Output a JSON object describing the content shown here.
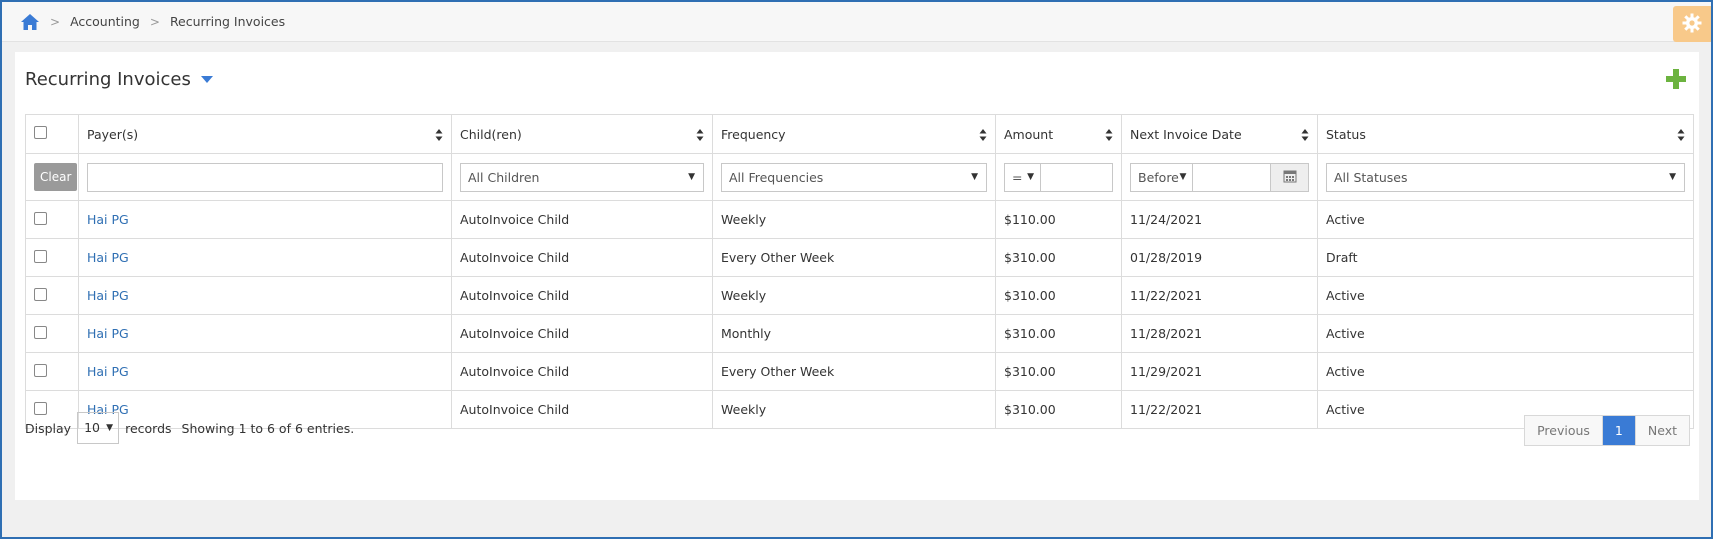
{
  "breadcrumb": {
    "items": [
      "Accounting",
      "Recurring Invoices"
    ]
  },
  "icons": {
    "home": "home-icon",
    "settings": "gear-icon",
    "add": "plus-icon",
    "calendar": "calendar-icon",
    "sort": "sort-icon"
  },
  "colors": {
    "accent": "#3a7bd5",
    "link": "#2f6fb3",
    "add": "#6cb33f",
    "settings_bg": "#f8c98a"
  },
  "panel": {
    "title": "Recurring Invoices"
  },
  "table": {
    "columns": [
      "Payer(s)",
      "Child(ren)",
      "Frequency",
      "Amount",
      "Next Invoice Date",
      "Status"
    ],
    "filters": {
      "clear_label": "Clear",
      "payer_value": "",
      "children": "All Children",
      "frequency": "All Frequencies",
      "amount_op": "=",
      "amount_value": "",
      "date_op": "Before",
      "date_value": "",
      "status": "All Statuses"
    },
    "rows": [
      {
        "payer": "Hai PG",
        "child": "AutoInvoice Child",
        "frequency": "Weekly",
        "amount": "$110.00",
        "next_date": "11/24/2021",
        "status": "Active"
      },
      {
        "payer": "Hai PG",
        "child": "AutoInvoice Child",
        "frequency": "Every Other Week",
        "amount": "$310.00",
        "next_date": "01/28/2019",
        "status": "Draft"
      },
      {
        "payer": "Hai PG",
        "child": "AutoInvoice Child",
        "frequency": "Weekly",
        "amount": "$310.00",
        "next_date": "11/22/2021",
        "status": "Active"
      },
      {
        "payer": "Hai PG",
        "child": "AutoInvoice Child",
        "frequency": "Monthly",
        "amount": "$310.00",
        "next_date": "11/28/2021",
        "status": "Active"
      },
      {
        "payer": "Hai PG",
        "child": "AutoInvoice Child",
        "frequency": "Every Other Week",
        "amount": "$310.00",
        "next_date": "11/29/2021",
        "status": "Active"
      },
      {
        "payer": "Hai PG",
        "child": "AutoInvoice Child",
        "frequency": "Weekly",
        "amount": "$310.00",
        "next_date": "11/22/2021",
        "status": "Active"
      }
    ]
  },
  "footer": {
    "display_label": "Display",
    "page_length": "10",
    "records_label": "records",
    "info": "Showing 1 to 6 of 6 entries."
  },
  "pager": {
    "previous": "Previous",
    "current": "1",
    "next": "Next"
  }
}
